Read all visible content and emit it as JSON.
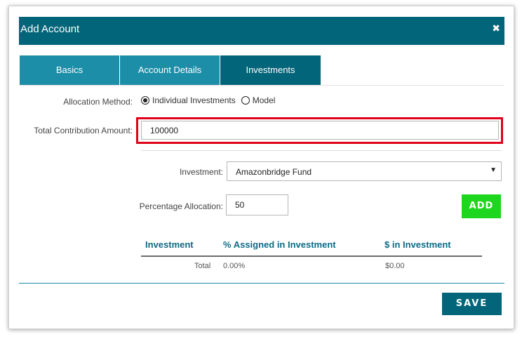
{
  "dialog": {
    "title": "Add Account",
    "close_glyph": "✖"
  },
  "tabs": [
    {
      "label": "Basics",
      "active": false
    },
    {
      "label": "Account Details",
      "active": false
    },
    {
      "label": "Investments",
      "active": true
    }
  ],
  "allocation": {
    "label": "Allocation Method:",
    "options": [
      {
        "label": "Individual Investments",
        "selected": true
      },
      {
        "label": "Model",
        "selected": false
      }
    ]
  },
  "contribution": {
    "label": "Total Contribution Amount:",
    "value": "100000"
  },
  "investment": {
    "label": "Investment:",
    "selected": "Amazonbridge Fund",
    "arrow_glyph": "▼"
  },
  "percentage": {
    "label": "Percentage Allocation:",
    "value": "50"
  },
  "add_label": "ADD",
  "table": {
    "headers": [
      "Investment",
      "% Assigned in Investment",
      "$ in Investment"
    ],
    "total_row": {
      "label": "Total",
      "percent": "0.00%",
      "amount": "$0.00"
    }
  },
  "save_label": "SAVE",
  "colors": {
    "header": "#036579",
    "tab": "#1c8ea8",
    "add_button": "#1ed61e",
    "highlight": "#e0001a"
  }
}
